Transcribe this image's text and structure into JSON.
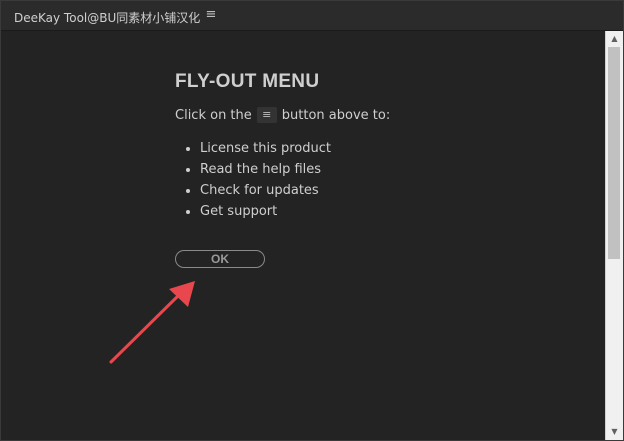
{
  "window": {
    "title": "DeeKay Tool@BU同素材小铺汉化",
    "menu_icon": "hamburger-icon",
    "menu_glyph": "≡"
  },
  "content": {
    "heading": "FLY-OUT MENU",
    "intro_before": "Click on the",
    "intro_chip_glyph": "≡",
    "intro_after": "button above to:",
    "items": [
      "License this product",
      "Read the help files",
      "Check for updates",
      "Get support"
    ],
    "ok_label": "OK"
  },
  "annotation": {
    "arrow_icon": "pointer-arrow",
    "color": "#e8484d"
  },
  "scrollbar": {
    "up_glyph": "▲",
    "down_glyph": "▼"
  },
  "colors": {
    "background": "#232323",
    "text": "#cfcfcf",
    "button_border": "#8a8a8a"
  }
}
